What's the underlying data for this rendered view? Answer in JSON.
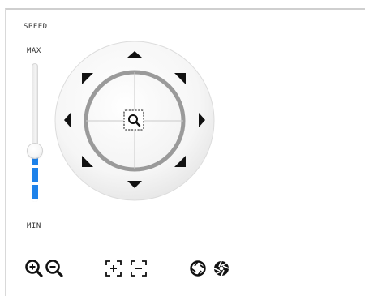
{
  "labels": {
    "speed": "SPEED",
    "max": "MAX",
    "min": "MIN"
  },
  "speed_slider": {
    "level_percent": 37
  },
  "ptz_control": {
    "directions": [
      "up",
      "up-right",
      "right",
      "down-right",
      "down",
      "down-left",
      "left",
      "up-left"
    ],
    "center_icon": "zoom-area-icon"
  },
  "toolbar": {
    "icons": [
      "zoom-in-icon",
      "zoom-out-icon",
      "focus-near-icon",
      "focus-far-icon",
      "iris-open-icon",
      "iris-close-icon"
    ]
  },
  "colors": {
    "accent": "#1e82ea",
    "control_dark": "#111111",
    "dial_ring": "#9a9a9a"
  }
}
